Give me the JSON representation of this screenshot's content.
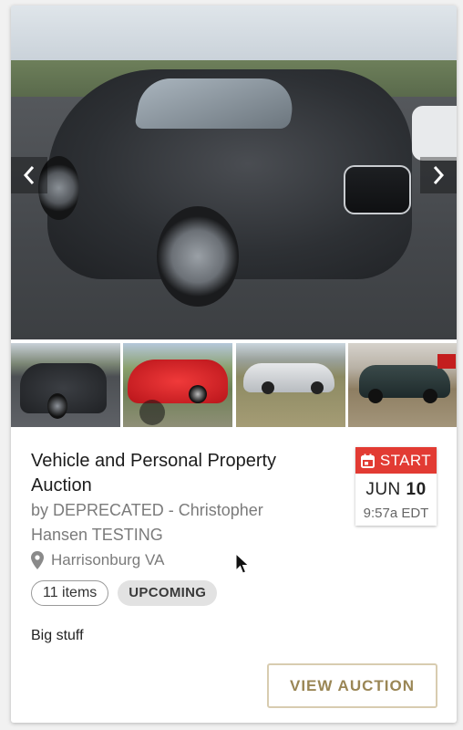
{
  "gallery": {
    "main_image": "gray-acura-suv-photo",
    "prev_icon": "chevron-left-icon",
    "next_icon": "chevron-right-icon",
    "thumbnails": [
      {
        "image": "gray-suv-thumbnail"
      },
      {
        "image": "red-sedan-thumbnail"
      },
      {
        "image": "silver-sedan-thumbnail"
      },
      {
        "image": "dark-sedan-thumbnail"
      }
    ]
  },
  "auction": {
    "title": "Vehicle and Personal Property Auction",
    "byline": "by DEPRECATED - Christopher Hansen TESTING",
    "location": "Harrisonburg VA",
    "items_count": "11 items",
    "status": "UPCOMING",
    "description": "Big stuff"
  },
  "start": {
    "label": "START",
    "month": "JUN",
    "day": "10",
    "time": "9:57a EDT"
  },
  "actions": {
    "view_label": "VIEW AUCTION"
  },
  "colors": {
    "start_red": "#e23b33",
    "button_gold": "#9a8655",
    "button_border": "#d8ccb0"
  }
}
